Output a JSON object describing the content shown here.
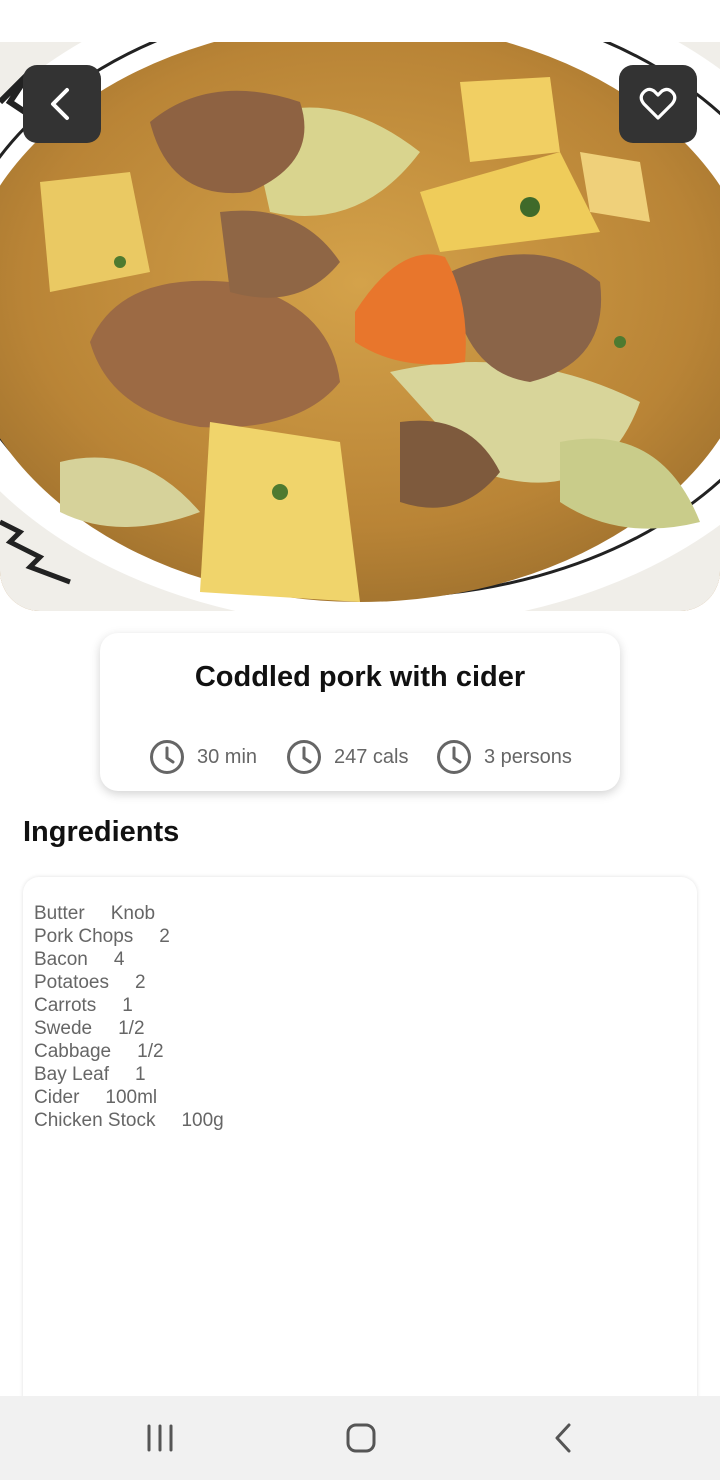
{
  "hero": {
    "image": "pork-stew-photo"
  },
  "toolbar": {
    "back_icon": "chevron-left-icon",
    "favorite_icon": "heart-outline-icon"
  },
  "recipe": {
    "title": "Coddled pork with cider",
    "stats": {
      "time": "30 min",
      "calories": "247 cals",
      "servings": "3 persons"
    },
    "stat_icon": "clock-icon"
  },
  "ingredients": {
    "heading": "Ingredients",
    "items": [
      {
        "name": "Butter",
        "qty": "Knob"
      },
      {
        "name": "Pork Chops",
        "qty": "2"
      },
      {
        "name": "Bacon",
        "qty": "4"
      },
      {
        "name": "Potatoes",
        "qty": "2"
      },
      {
        "name": "Carrots",
        "qty": "1"
      },
      {
        "name": "Swede",
        "qty": "1/2"
      },
      {
        "name": "Cabbage",
        "qty": "1/2"
      },
      {
        "name": "Bay Leaf",
        "qty": "1"
      },
      {
        "name": "Cider",
        "qty": "100ml"
      },
      {
        "name": "Chicken Stock",
        "qty": "100g"
      }
    ]
  },
  "navbar": {
    "recent_icon": "recent-apps-icon",
    "home_icon": "home-icon",
    "back_icon": "nav-back-icon"
  },
  "colors": {
    "button_bg": "#333333",
    "stat_text": "#666666",
    "navbar_bg": "#f1f1f1"
  }
}
